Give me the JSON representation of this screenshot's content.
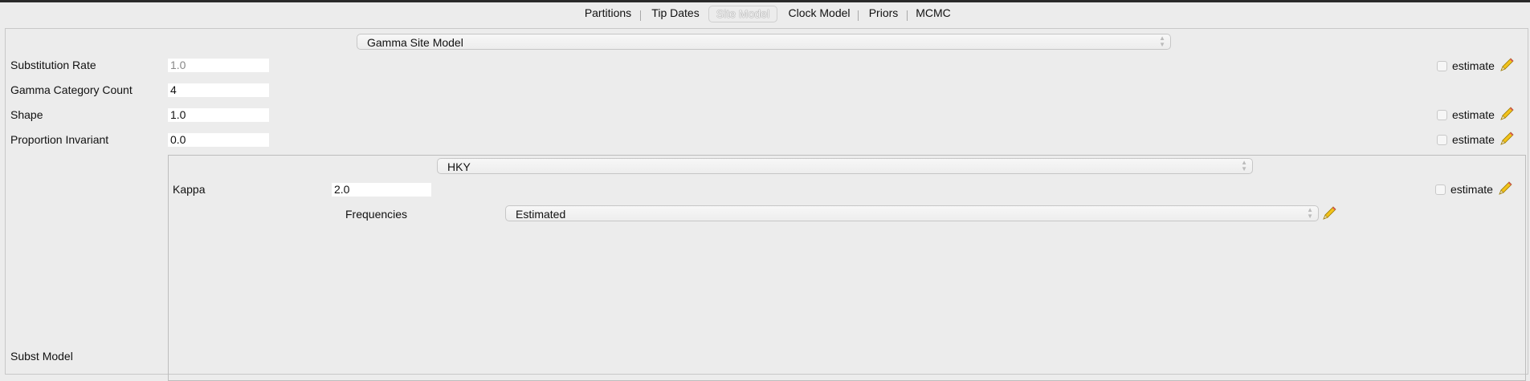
{
  "tabs": [
    {
      "label": "Partitions"
    },
    {
      "label": "Tip Dates"
    },
    {
      "label": "Site Model"
    },
    {
      "label": "Clock Model"
    },
    {
      "label": "Priors"
    },
    {
      "label": "MCMC"
    }
  ],
  "site_model": {
    "selector": "Gamma Site Model",
    "substitution_rate": {
      "label": "Substitution Rate",
      "value": "1.0",
      "estimate_label": "estimate",
      "estimate_checked": false
    },
    "gamma_category_count": {
      "label": "Gamma Category Count",
      "value": "4"
    },
    "shape": {
      "label": "Shape",
      "value": "1.0",
      "estimate_label": "estimate",
      "estimate_checked": false
    },
    "proportion_invariant": {
      "label": "Proportion Invariant",
      "value": "0.0",
      "estimate_label": "estimate",
      "estimate_checked": false
    },
    "subst_model_label": "Subst Model"
  },
  "subst_model": {
    "selector": "HKY",
    "kappa": {
      "label": "Kappa",
      "value": "2.0",
      "estimate_label": "estimate",
      "estimate_checked": false
    },
    "frequencies": {
      "label": "Frequencies",
      "value": "Estimated"
    }
  },
  "icons": {
    "edit": "pencil-icon",
    "combo_arrows": "up-down-chevron-icon"
  },
  "colors": {
    "pencil": "#f2c21b",
    "background": "#ececec",
    "field": "#ffffff"
  }
}
